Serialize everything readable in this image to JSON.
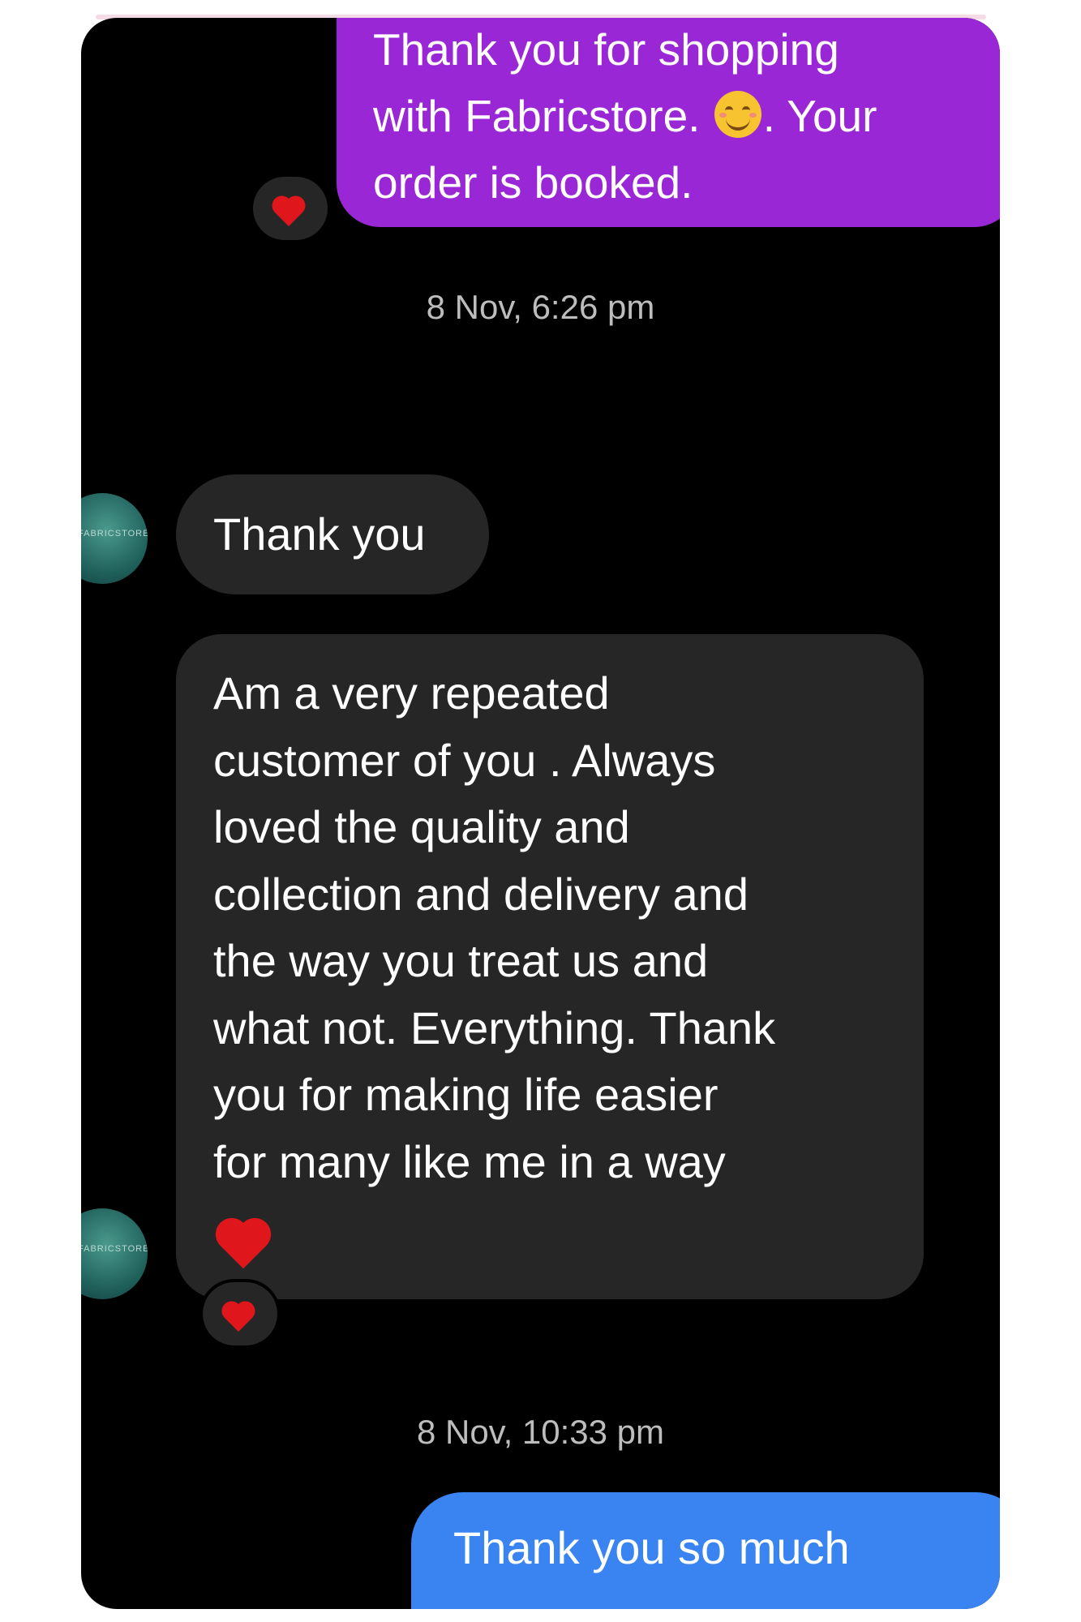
{
  "conversation": {
    "outgoing_first": {
      "lines": [
        "Thank you for shopping",
        "with Fabricstore.",
        ". Your",
        "order is booked."
      ],
      "emoji": "smiling-face-icon"
    },
    "reaction_1": "heart-icon",
    "timestamp_1": "8 Nov, 6:26 pm",
    "incoming_1": "Thank you",
    "incoming_2": {
      "lines": [
        "Am a very repeated",
        "customer of you . Always",
        "loved the quality and",
        "collection and delivery and",
        "the way you treat us and",
        "what not. Everything.  Thank",
        "you for making life easier",
        "for many like me in a way"
      ],
      "emoji": "red-heart-icon"
    },
    "avatar_text": "FABRICSTORE",
    "reaction_2": "heart-icon",
    "timestamp_2": "8 Nov, 10:33 pm",
    "outgoing_last": "Thank you so much"
  },
  "colors": {
    "background": "#000000",
    "outgoing_purple": "#9a27d6",
    "outgoing_blue": "#3a84f1",
    "incoming": "#262626",
    "heart": "#e0161d",
    "timestamp": "#bdbdbd"
  }
}
